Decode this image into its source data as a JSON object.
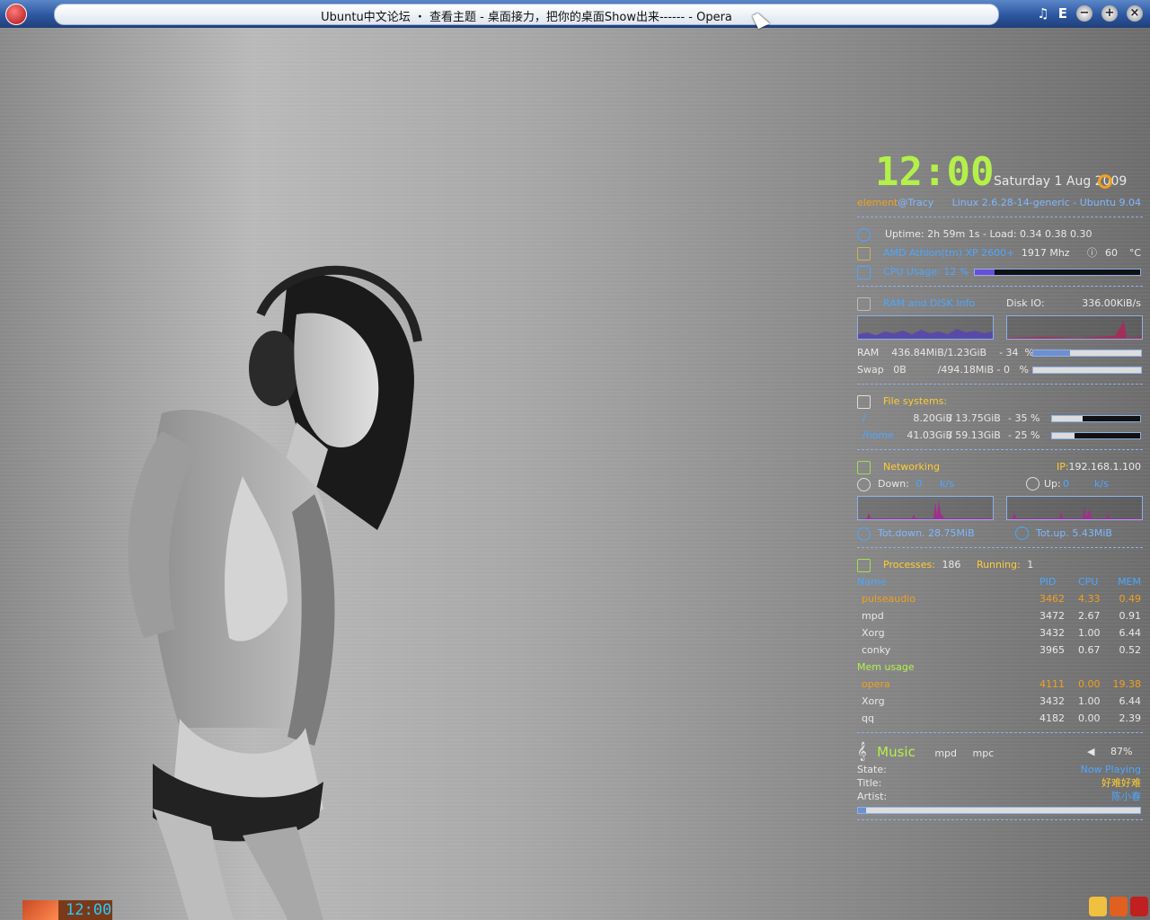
{
  "window": {
    "title": "Ubuntu中文论坛 ・ 查看主题 - 桌面接力，把你的桌面Show出来------ - Opera",
    "menu_glyph": "♫",
    "e_glyph": "E"
  },
  "conky": {
    "time": "12:00",
    "date": "Saturday  1 Aug 2009",
    "user": "element",
    "host": "Tracy",
    "kernel": "Linux 2.6.28-14-generic - Ubuntu 9.04",
    "uptime": "Uptime: 2h 59m 1s - Load: 0.34 0.38 0.30",
    "cpu_name": "AMD Athlon(tm) XP 2600+",
    "cpu_mhz": "1917 Mhz",
    "cpu_temp": "60",
    "temp_unit": "°C",
    "cpu_usage_label": "CPU Usage: 12 %",
    "cpu_usage_pct": 12,
    "ram_disk_label": "RAM and DISK Info",
    "disk_io_label": "Disk IO:",
    "disk_io_value": "336.00KiB/s",
    "ram_line": "RAM    436.84MiB/1.23GiB    - 34  %",
    "ram_pct": 34,
    "swap_line": "Swap   0B          /494.18MiB - 0   %",
    "swap_pct": 0,
    "fs_label": "File systems:",
    "fs": [
      {
        "mount": "/",
        "used": "8.20GiB",
        "total": "/ 13.75GiB",
        "pct_text": "- 35  %",
        "pct": 35
      },
      {
        "mount": "/home",
        "used": "41.03GiB",
        "total": "/ 59.13GiB",
        "pct_text": "- 25  %",
        "pct": 25
      }
    ],
    "net_label": "Networking",
    "ip_label": "IP:",
    "ip_value": "192.168.1.100",
    "down_label": "Down:",
    "down_value": "0",
    "up_label": "Up:",
    "up_value": "0",
    "rate_unit": "k/s",
    "tot_down": "Tot.down. 28.75MiB",
    "tot_up": "Tot.up. 5.43MiB",
    "processes_label": "Processes:",
    "processes_value": "186",
    "running_label": "Running:",
    "running_value": "1",
    "proc_headers": {
      "name": "Name",
      "pid": "PID",
      "cpu": "CPU",
      "mem": "MEM"
    },
    "top_cpu": [
      {
        "name": "pulseaudio",
        "pid": "3462",
        "cpu": "4.33",
        "mem": "0.49"
      },
      {
        "name": "mpd",
        "pid": "3472",
        "cpu": "2.67",
        "mem": "0.91"
      },
      {
        "name": "Xorg",
        "pid": "3432",
        "cpu": "1.00",
        "mem": "6.44"
      },
      {
        "name": "conky",
        "pid": "3965",
        "cpu": "0.67",
        "mem": "0.52"
      }
    ],
    "mem_usage_label": "Mem usage",
    "top_mem": [
      {
        "name": "opera",
        "pid": "4111",
        "cpu": "0.00",
        "mem": "19.38"
      },
      {
        "name": "Xorg",
        "pid": "3432",
        "cpu": "1.00",
        "mem": "6.44"
      },
      {
        "name": "qq",
        "pid": "4182",
        "cpu": "0.00",
        "mem": "2.39"
      }
    ],
    "music_label": "Music",
    "mpd_label": "mpd",
    "mpc_label": "mpc",
    "volume": "87%",
    "state_label": "State:",
    "state_value": "Now Playing",
    "title_label": "Title:",
    "title_value": "好难好难",
    "artist_label": "Artist:",
    "artist_value": "陈小春",
    "progress_pct": 3
  },
  "taskbar": {
    "clock": "12:00"
  },
  "colors": {
    "accent_blue": "#4da6ff",
    "yellow": "#ffcc33",
    "green": "#b4f04a",
    "title_bar": "#2c57a0"
  }
}
